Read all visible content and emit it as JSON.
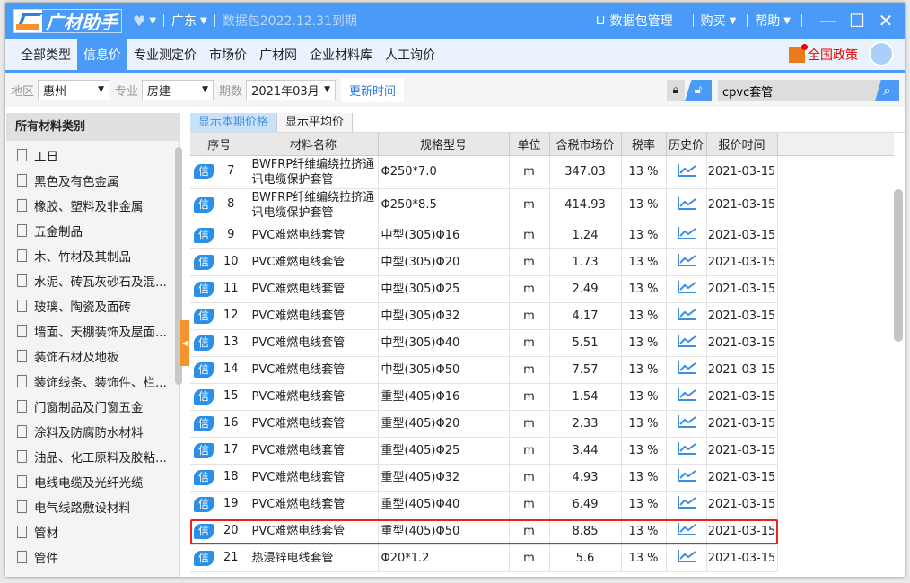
{
  "app": {
    "name": "广材助手",
    "region": "广东",
    "expiry": "数据包2022.12.31到期",
    "data_pkg": "数据包管理",
    "buy": "购买",
    "help": "帮助"
  },
  "nav": {
    "tabs": [
      "全部类型",
      "信息价",
      "专业测定价",
      "市场价",
      "广材网",
      "企业材料库",
      "人工询价"
    ],
    "active": 1,
    "policy": "全国政策"
  },
  "filter": {
    "area_label": "地区",
    "area": "惠州",
    "major_label": "专业",
    "major": "房建",
    "period_label": "期数",
    "period": "2021年03月",
    "refresh": "更新时间",
    "search_value": "cpvc套管"
  },
  "sidebar": {
    "title": "所有材料类别",
    "items": [
      "工日",
      "黑色及有色金属",
      "橡胶、塑料及非金属",
      "五金制品",
      "木、竹材及其制品",
      "水泥、砖瓦灰砂石及混...",
      "玻璃、陶瓷及面砖",
      "墙面、天棚装饰及屋面...",
      "装饰石材及地板",
      "装饰线条、装饰件、栏...",
      "门窗制品及门窗五金",
      "涂料及防腐防水材料",
      "油品、化工原料及胶粘...",
      "电线电缆及光纤光缆",
      "电气线路敷设材料",
      "管材",
      "管件"
    ]
  },
  "price_tabs": [
    "显示本期价格",
    "显示平均价"
  ],
  "table": {
    "headers": [
      "序号",
      "材料名称",
      "规格型号",
      "单位",
      "含税市场价",
      "税率",
      "历史价",
      "报价时间"
    ],
    "badge": "信",
    "rows": [
      {
        "no": "7",
        "name": "BWFRP纤维编绕拉挤通讯电缆保护套管",
        "spec": "Φ250*7.0",
        "unit": "m",
        "price": "347.03",
        "tax": "13 %",
        "date": "2021-03-15"
      },
      {
        "no": "8",
        "name": "BWFRP纤维编绕拉挤通讯电缆保护套管",
        "spec": "Φ250*8.5",
        "unit": "m",
        "price": "414.93",
        "tax": "13 %",
        "date": "2021-03-15"
      },
      {
        "no": "9",
        "name": "PVC难燃电线套管",
        "spec": "中型(305)Φ16",
        "unit": "m",
        "price": "1.24",
        "tax": "13 %",
        "date": "2021-03-15"
      },
      {
        "no": "10",
        "name": "PVC难燃电线套管",
        "spec": "中型(305)Φ20",
        "unit": "m",
        "price": "1.73",
        "tax": "13 %",
        "date": "2021-03-15"
      },
      {
        "no": "11",
        "name": "PVC难燃电线套管",
        "spec": "中型(305)Φ25",
        "unit": "m",
        "price": "2.49",
        "tax": "13 %",
        "date": "2021-03-15"
      },
      {
        "no": "12",
        "name": "PVC难燃电线套管",
        "spec": "中型(305)Φ32",
        "unit": "m",
        "price": "4.17",
        "tax": "13 %",
        "date": "2021-03-15"
      },
      {
        "no": "13",
        "name": "PVC难燃电线套管",
        "spec": "中型(305)Φ40",
        "unit": "m",
        "price": "5.51",
        "tax": "13 %",
        "date": "2021-03-15"
      },
      {
        "no": "14",
        "name": "PVC难燃电线套管",
        "spec": "中型(305)Φ50",
        "unit": "m",
        "price": "7.57",
        "tax": "13 %",
        "date": "2021-03-15"
      },
      {
        "no": "15",
        "name": "PVC难燃电线套管",
        "spec": "重型(405)Φ16",
        "unit": "m",
        "price": "1.54",
        "tax": "13 %",
        "date": "2021-03-15"
      },
      {
        "no": "16",
        "name": "PVC难燃电线套管",
        "spec": "重型(405)Φ20",
        "unit": "m",
        "price": "2.33",
        "tax": "13 %",
        "date": "2021-03-15"
      },
      {
        "no": "17",
        "name": "PVC难燃电线套管",
        "spec": "重型(405)Φ25",
        "unit": "m",
        "price": "3.44",
        "tax": "13 %",
        "date": "2021-03-15"
      },
      {
        "no": "18",
        "name": "PVC难燃电线套管",
        "spec": "重型(405)Φ32",
        "unit": "m",
        "price": "4.93",
        "tax": "13 %",
        "date": "2021-03-15"
      },
      {
        "no": "19",
        "name": "PVC难燃电线套管",
        "spec": "重型(405)Φ40",
        "unit": "m",
        "price": "6.49",
        "tax": "13 %",
        "date": "2021-03-15"
      },
      {
        "no": "20",
        "name": "PVC难燃电线套管",
        "spec": "重型(405)Φ50",
        "unit": "m",
        "price": "8.85",
        "tax": "13 %",
        "date": "2021-03-15"
      },
      {
        "no": "21",
        "name": "热浸锌电线套管",
        "spec": "Φ20*1.2",
        "unit": "m",
        "price": "5.6",
        "tax": "13 %",
        "date": "2021-03-15"
      }
    ]
  },
  "colors": {
    "brand": "#4a9bf8",
    "accent": "#f7932c",
    "highlight": "#f02020"
  }
}
